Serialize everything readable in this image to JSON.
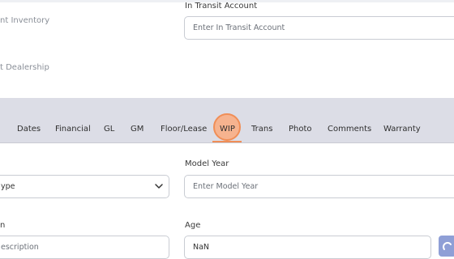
{
  "upper_section": {
    "inventory_label": "nt Inventory",
    "dealership_label": "t Dealership",
    "in_transit_label": "In Transit Account",
    "in_transit_placeholder": "Enter In Transit Account"
  },
  "tabs": [
    {
      "label": "Dates"
    },
    {
      "label": "Financial"
    },
    {
      "label": "GL"
    },
    {
      "label": "GM"
    },
    {
      "label": "Floor/Lease"
    },
    {
      "label": "WIP",
      "active": true
    },
    {
      "label": "Trans"
    },
    {
      "label": "Photo"
    },
    {
      "label": "Comments"
    },
    {
      "label": "Warranty"
    }
  ],
  "form": {
    "type_value": "ype",
    "model_year_label": "Model Year",
    "model_year_placeholder": "Enter Model Year",
    "description_label": "n",
    "description_placeholder": "escription",
    "age_label": "Age",
    "age_value": "NaN"
  },
  "colors": {
    "tabbar_bg": "#dcdde6",
    "accent": "#f08e57",
    "accent_fill": "#f6b38f",
    "side_button": "#8f9fd6"
  },
  "icons": {
    "dropdown": "chevron-down-icon",
    "side_button": "action-icon"
  }
}
